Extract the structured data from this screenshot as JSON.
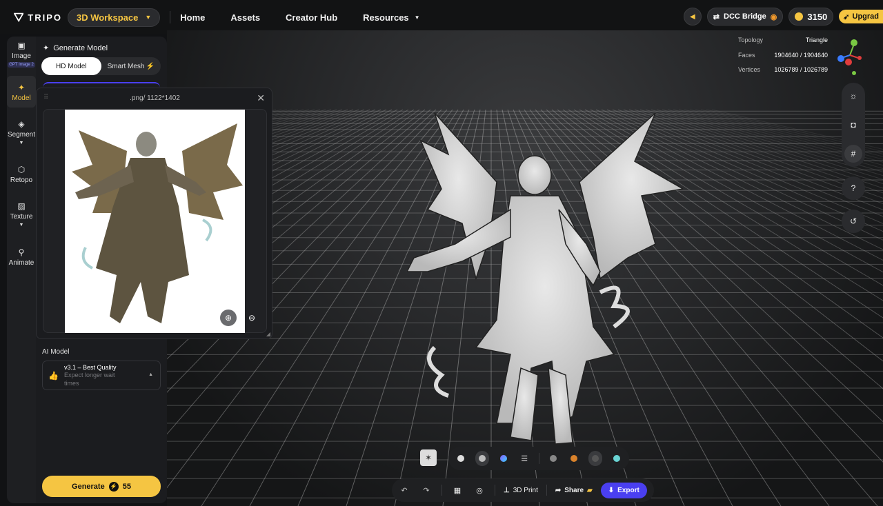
{
  "app": {
    "logo_text": "TRIPO",
    "workspace_label": "3D Workspace",
    "nav": [
      {
        "label": "Home",
        "has_dropdown": false
      },
      {
        "label": "Assets",
        "has_dropdown": false
      },
      {
        "label": "Creator Hub",
        "has_dropdown": false
      },
      {
        "label": "Resources",
        "has_dropdown": true
      }
    ],
    "dcc_bridge_label": "DCC Bridge",
    "credits": "3150",
    "upgrade_label": "Upgrad",
    "accent_color": "#f5c542",
    "export_color": "#4a3ff0"
  },
  "rail": [
    {
      "label": "Image",
      "icon": "image-icon",
      "badge": "GPT Image 2",
      "active": false
    },
    {
      "label": "Model",
      "icon": "sparkle-icon",
      "active": true
    },
    {
      "label": "Segment",
      "icon": "cube-icon",
      "has_dropdown": true,
      "active": false
    },
    {
      "label": "Retopo",
      "icon": "retopo-icon",
      "active": false
    },
    {
      "label": "Texture",
      "icon": "texture-icon",
      "has_dropdown": true,
      "active": false
    },
    {
      "label": "Animate",
      "icon": "running-person-icon",
      "active": false
    }
  ],
  "panel": {
    "title": "Generate Model",
    "mode_options": [
      "HD Model",
      "Smart Mesh"
    ],
    "selected_mode": "HD Model",
    "ai_model_label": "AI Model",
    "ai_model_title": "v3.1 – Best Quality",
    "ai_model_desc": "Expect longer wait times",
    "generate_label": "Generate",
    "generate_cost": "55"
  },
  "popup": {
    "title": ".png/ 1122*1402"
  },
  "viewport": {
    "stats": [
      {
        "label": "Topology",
        "value": "Triangle"
      },
      {
        "label": "Faces",
        "value": "1904640 / 1904640"
      },
      {
        "label": "Vertices",
        "value": "1026789 / 1026789"
      }
    ]
  },
  "toolbar": {
    "print_label": "3D Print",
    "share_label": "Share",
    "export_label": "Export"
  }
}
